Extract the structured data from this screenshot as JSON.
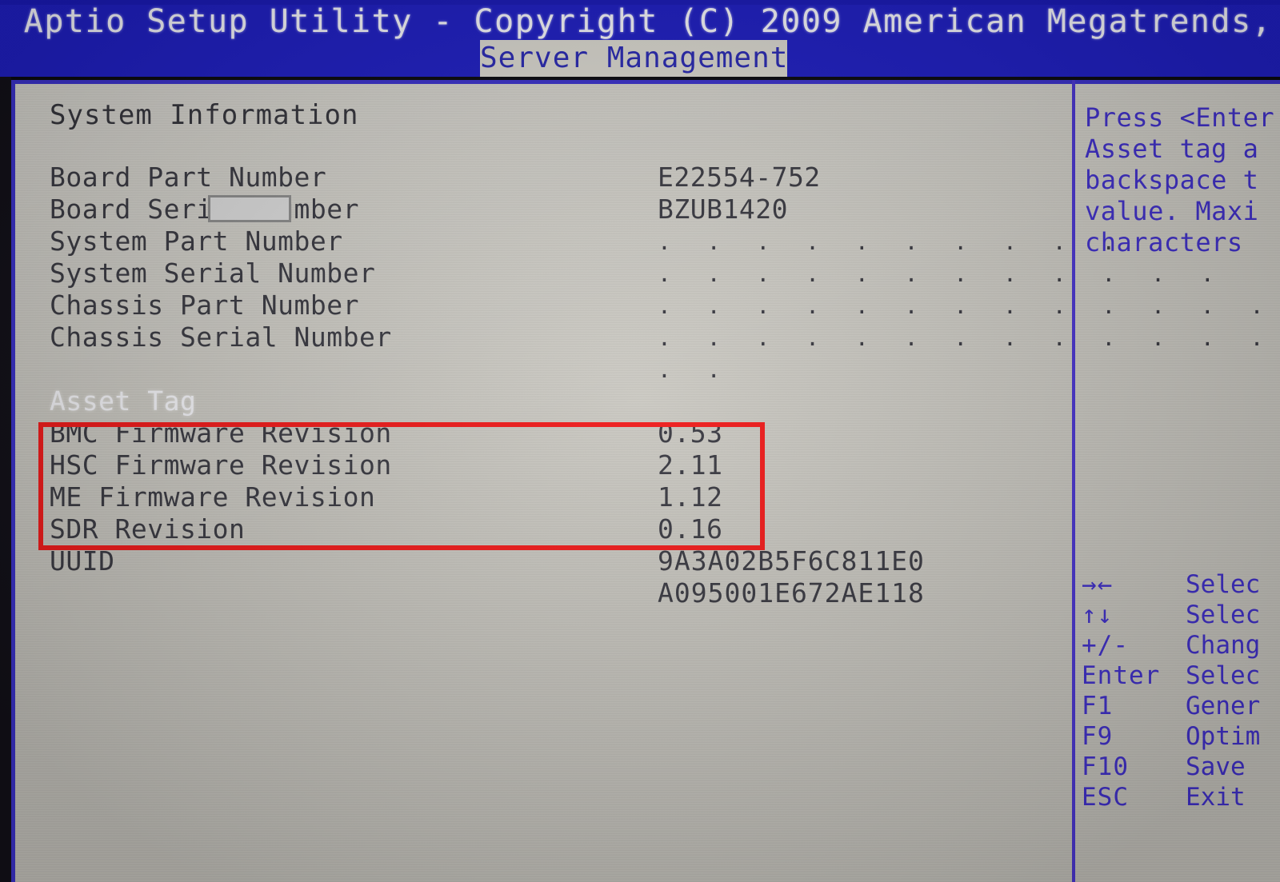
{
  "header": {
    "title": "Aptio Setup Utility - Copyright (C) 2009 American Megatrends,",
    "active_tab": "Server Management"
  },
  "main": {
    "section_title": "System Information",
    "rows": [
      {
        "label": "Board Part Number",
        "value": "E22554-752",
        "type": "text",
        "selected": false
      },
      {
        "label": "Board Serial Number",
        "value": "BZUB1420",
        "type": "redacted",
        "selected": false
      },
      {
        "label": "System Part Number",
        "value": ". . . . . . . . . .",
        "type": "dots",
        "selected": false
      },
      {
        "label": "System Serial Number",
        "value": ". . . . . . . . . . . .",
        "type": "dots",
        "selected": false
      },
      {
        "label": "Chassis Part Number",
        "value": ". . . . . . . . . . . . . . . . . .",
        "type": "dots",
        "selected": false
      },
      {
        "label": "Chassis Serial Number",
        "value": ". . . . . . . . . . . . . . .",
        "type": "dots",
        "selected": false
      },
      {
        "label": "",
        "value": ". .",
        "type": "dots",
        "selected": false
      },
      {
        "label": "Asset Tag",
        "value": "",
        "type": "text",
        "selected": true
      },
      {
        "label": "BMC Firmware Revision",
        "value": "0.53",
        "type": "text",
        "selected": false
      },
      {
        "label": "HSC Firmware Revision",
        "value": "2.11",
        "type": "text",
        "selected": false
      },
      {
        "label": "ME Firmware Revision",
        "value": "1.12",
        "type": "text",
        "selected": false
      },
      {
        "label": "SDR Revision",
        "value": "0.16",
        "type": "text",
        "selected": false
      },
      {
        "label": "UUID",
        "value": "9A3A02B5F6C811E0",
        "type": "hex",
        "selected": false
      },
      {
        "label": "",
        "value": "A095001E672AE118",
        "type": "hex",
        "selected": false
      }
    ]
  },
  "annotation": {
    "color": "#ef1b1b",
    "highlights": [
      "BMC Firmware Revision",
      "HSC Firmware Revision",
      "ME Firmware Revision",
      "SDR Revision"
    ]
  },
  "help": {
    "lines": [
      "Press <Enter",
      "Asset tag a",
      "backspace t",
      "value. Maxi",
      "characters"
    ]
  },
  "legend": {
    "rows": [
      {
        "key": "→←",
        "desc": "Selec"
      },
      {
        "key": "↑↓",
        "desc": "Selec"
      },
      {
        "key": "+/-",
        "desc": "Chang"
      },
      {
        "key": "Enter",
        "desc": "Selec"
      },
      {
        "key": "F1",
        "desc": "Gener"
      },
      {
        "key": "F9",
        "desc": "Optim"
      },
      {
        "key": "F10",
        "desc": "Save"
      },
      {
        "key": "ESC",
        "desc": "Exit"
      }
    ]
  },
  "colors": {
    "header_blue": "#1f1fc0",
    "panel_gray": "#cfcdc6",
    "text_dark": "#3a3a42",
    "help_blue": "#4030c8",
    "annotation_red": "#ef1b1b",
    "tab_bg": "#d6d4cc"
  }
}
